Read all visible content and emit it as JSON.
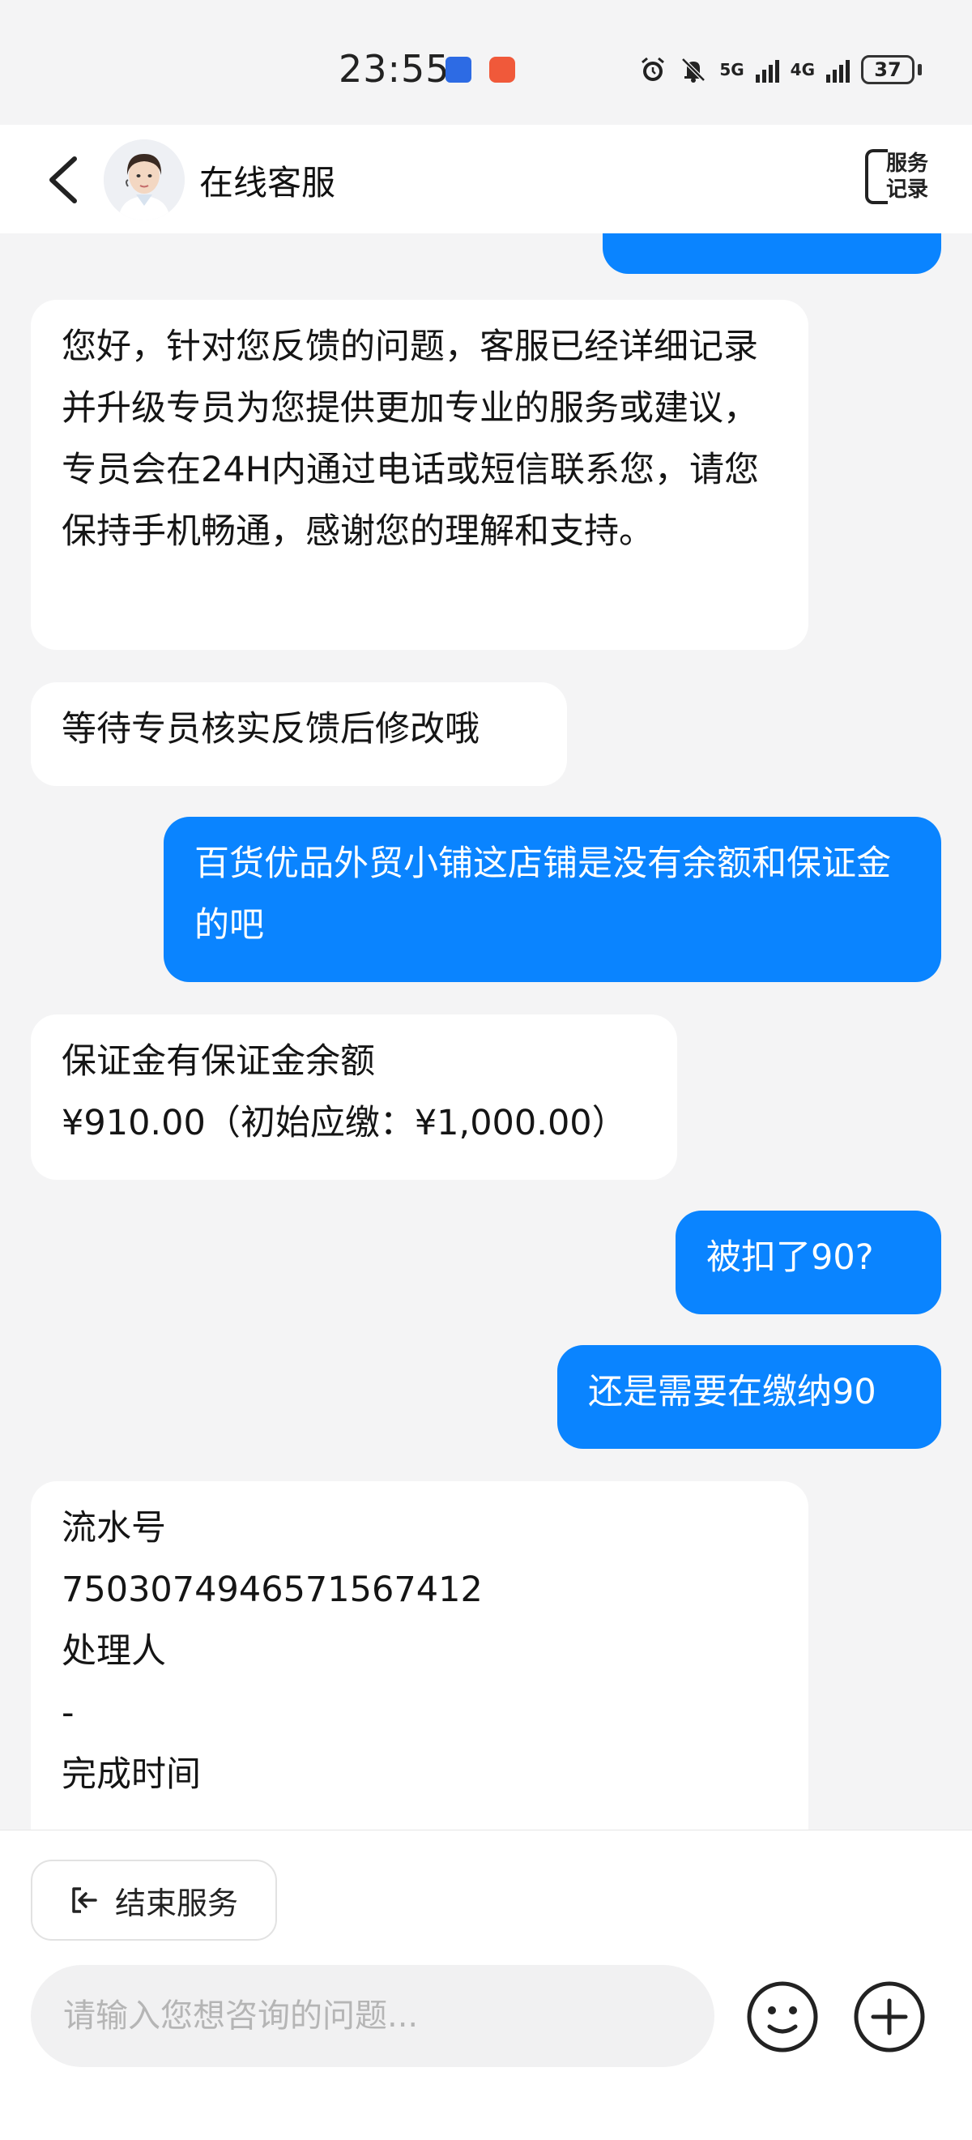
{
  "status_bar": {
    "time": "23:55",
    "network_5g": "5G",
    "network_4g": "4G",
    "battery": "37"
  },
  "header": {
    "title": "在线客服",
    "records_line1": "服务",
    "records_line2": "记录"
  },
  "messages": [
    {
      "from": "agent",
      "text": "您好，针对您反馈的问题，客服已经详细记录并升级专员为您提供更加专业的服务或建议，专员会在24H内通过电话或短信联系您，请您保持手机畅通，感谢您的理解和支持。"
    },
    {
      "from": "agent",
      "text": "等待专员核实反馈后修改哦"
    },
    {
      "from": "user",
      "text": "百货优品外贸小铺这店铺是没有余额和保证金的吧"
    },
    {
      "from": "agent",
      "line1": "保证金有保证金余额",
      "line2": "¥910.00（初始应缴：¥1,000.00）"
    },
    {
      "from": "user",
      "text": "被扣了90?"
    },
    {
      "from": "user",
      "text": "还是需要在缴纳90"
    },
    {
      "from": "agent",
      "label1": "流水号",
      "value1": "7503074946571567412",
      "label2": "处理人",
      "value2": "-",
      "label3": "完成时间"
    }
  ],
  "bottom": {
    "end_service": "结束服务",
    "input_placeholder": "请输入您想咨询的问题..."
  },
  "colors": {
    "accent": "#0a84ff",
    "background": "#f4f4f5"
  },
  "icons": [
    "back-arrow-icon",
    "emoji-icon",
    "plus-icon",
    "exit-icon",
    "alarm-icon",
    "mute-icon"
  ]
}
